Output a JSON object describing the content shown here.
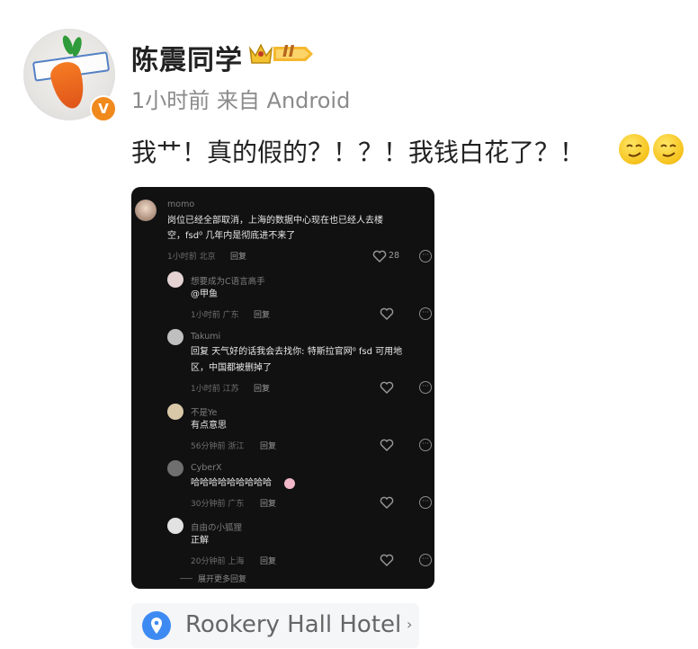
{
  "post": {
    "username": "陈震同学",
    "level_badge": "II",
    "meta": "1小时前 来自 Android",
    "text": "我艹！真的假的？！？！我钱白花了？！",
    "verified_mark": "V"
  },
  "screenshot": {
    "main_comment": {
      "name": "momo",
      "text_line1": "岗位已经全部取消，上海的数据中心现在也已经人去楼",
      "text_line2": "空，fsd⁰ 几年内是彻底进不来了",
      "meta": "1小时前 北京",
      "reply": "回复",
      "likes": "28"
    },
    "replies": [
      {
        "name": "想要成为C语言高手",
        "line1": "@甲鱼",
        "line2": "",
        "meta": "1小时前 广东",
        "reply": "回复"
      },
      {
        "name": "Takumi",
        "line1": "回复 天气好的话我会去找你: 特斯拉官网⁰ fsd 可用地",
        "line2": "区，中国都被删掉了",
        "meta": "1小时前 江苏",
        "reply": "回复"
      },
      {
        "name": "不是Ye",
        "line1": "有点意思",
        "line2": "",
        "meta": "56分钟前 浙江",
        "reply": "回复"
      },
      {
        "name": "CyberX",
        "line1": "哈哈哈哈哈哈哈哈哈",
        "line2": "",
        "meta": "30分钟前 广东",
        "reply": "回复"
      },
      {
        "name": "自由の小狐狸",
        "line1": "正解",
        "line2": "",
        "meta": "20分钟前 上海",
        "reply": "回复"
      }
    ],
    "expand_more": "展开更多回复"
  },
  "location": {
    "label": "Rookery Hall Hotel",
    "arrow": "›"
  },
  "icons": {
    "pin": "location-pin-icon",
    "heart": "heart-outline-icon",
    "more": "more-dots-icon",
    "crown": "crown-icon"
  },
  "colors": {
    "badge_orange": "#f08a1c",
    "pin_blue": "#3d8bf2",
    "dark_bg": "#111112"
  }
}
